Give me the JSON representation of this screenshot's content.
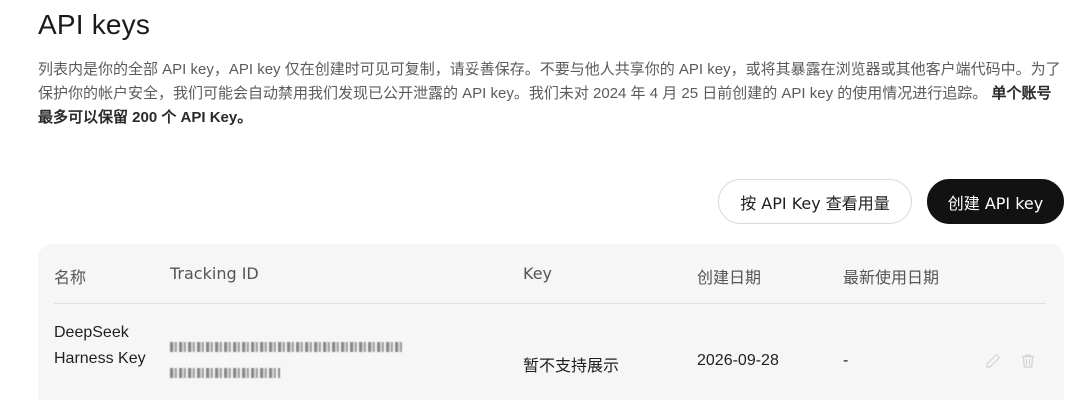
{
  "header": {
    "title": "API keys"
  },
  "description": {
    "text": "列表内是你的全部 API key，API key 仅在创建时可见可复制，请妥善保存。不要与他人共享你的 API key，或将其暴露在浏览器或其他客户端代码中。为了保护你的帐户安全，我们可能会自动禁用我们发现已公开泄露的 API key。我们未对 2024 年 4 月 25 日前创建的 API key 的使用情况进行追踪。",
    "strong": "单个账号最多可以保留 200 个 API Key。"
  },
  "actions": {
    "usage_label": "按 API Key 查看用量",
    "create_label": "创建 API key"
  },
  "table": {
    "columns": {
      "name": "名称",
      "tracking": "Tracking ID",
      "key": "Key",
      "created": "创建日期",
      "last_used": "最新使用日期"
    },
    "rows": [
      {
        "name": "DeepSeek Harness Key",
        "key": "暂不支持展示",
        "created": "2026-09-28",
        "last_used": "-"
      }
    ]
  },
  "icons": {
    "edit": "pencil-icon",
    "delete": "trash-icon"
  }
}
